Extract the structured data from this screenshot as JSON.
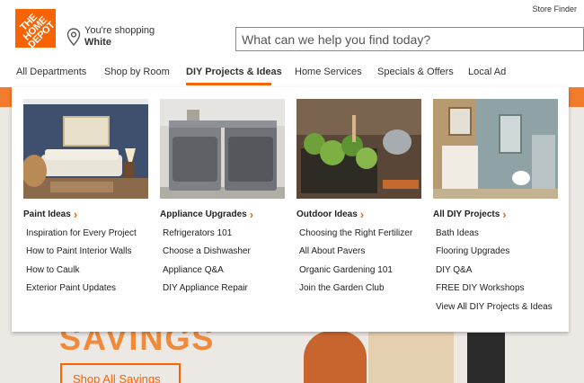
{
  "header": {
    "logo_text": "THE HOME DEPOT",
    "store_label": "You're shopping",
    "store_name": "White",
    "store_finder": "Store Finder",
    "search_placeholder": "What can we help you find today?"
  },
  "nav": {
    "items": [
      {
        "label": "All Departments"
      },
      {
        "label": "Shop by Room"
      },
      {
        "label": "DIY Projects & Ideas"
      },
      {
        "label": "Home Services"
      },
      {
        "label": "Specials & Offers"
      },
      {
        "label": "Local Ad"
      }
    ],
    "active": "DIY Projects & Ideas"
  },
  "background": {
    "savings_text": "SAVINGS",
    "shop_button": "Shop All Savings"
  },
  "dropdown": {
    "columns": [
      {
        "title": "Paint Ideas",
        "image": "living-room-image",
        "links": [
          "Inspiration for Every Project",
          "How to Paint Interior Walls",
          "How to Caulk",
          "Exterior Paint Updates"
        ]
      },
      {
        "title": "Appliance Upgrades",
        "image": "laundry-appliances-image",
        "links": [
          "Refrigerators 101",
          "Choose a Dishwasher",
          "Appliance Q&A",
          "DIY Appliance Repair"
        ]
      },
      {
        "title": "Outdoor Ideas",
        "image": "garden-seedlings-image",
        "links": [
          "Choosing the Right Fertilizer",
          "All About Pavers",
          "Organic Gardening 101",
          "Join the Garden Club"
        ]
      },
      {
        "title": "All DIY Projects",
        "image": "bathroom-image",
        "links": [
          "Bath Ideas",
          "Flooring Upgrades",
          "DIY Q&A",
          "FREE DIY Workshops",
          "View All DIY Projects & Ideas"
        ]
      }
    ]
  },
  "colors": {
    "brand_orange": "#f96302",
    "text": "#333333"
  }
}
